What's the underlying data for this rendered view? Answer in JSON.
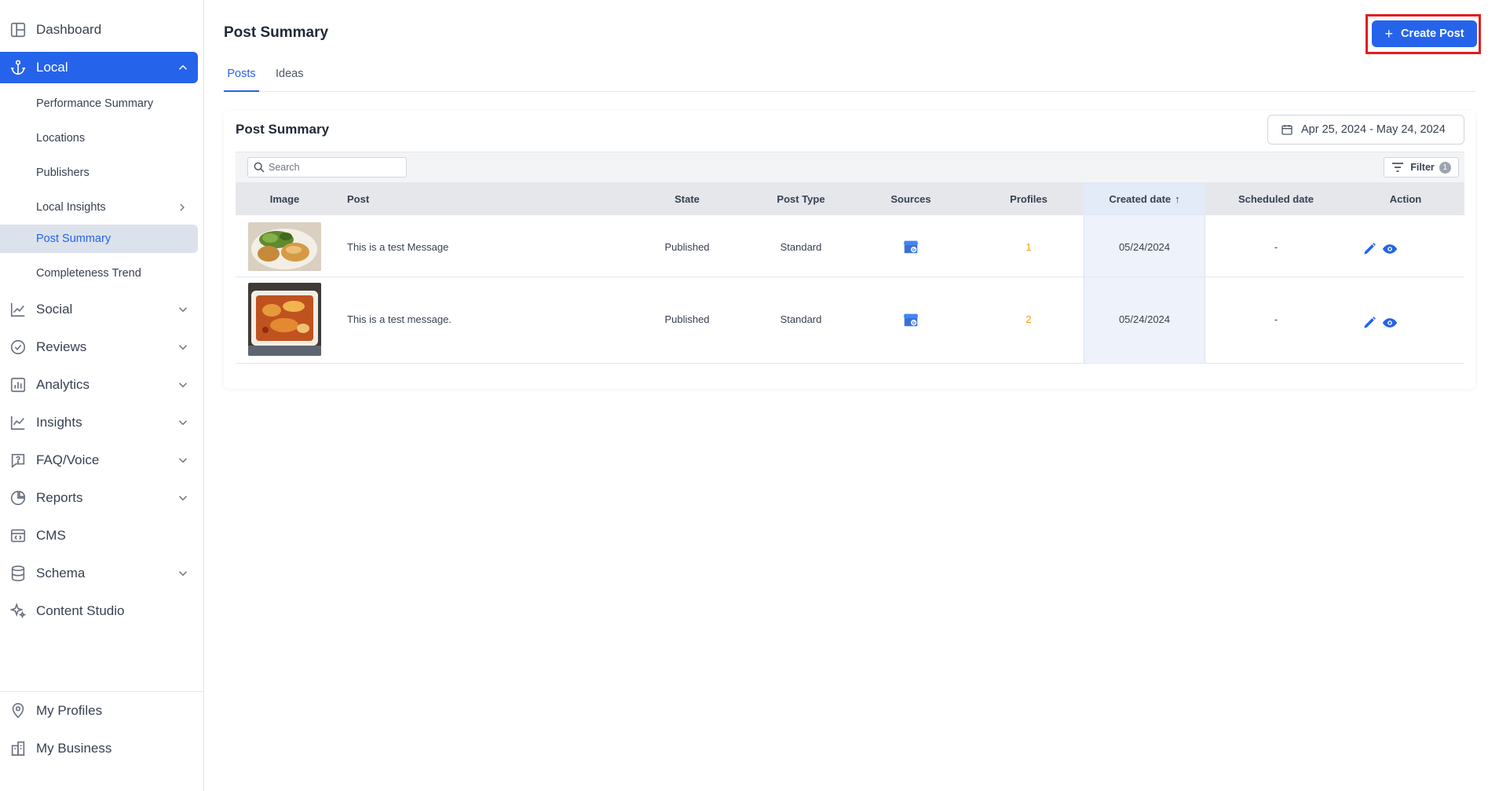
{
  "sidebar": {
    "top_items": [
      {
        "label": "Dashboard",
        "icon": "dashboard-icon"
      },
      {
        "label": "Local",
        "icon": "anchor-icon",
        "expanded": true
      }
    ],
    "local_sub": [
      {
        "label": "Performance Summary"
      },
      {
        "label": "Locations"
      },
      {
        "label": "Publishers"
      },
      {
        "label": "Local Insights",
        "has_children": true
      },
      {
        "label": "Post Summary",
        "selected": true
      },
      {
        "label": "Completeness Trend"
      }
    ],
    "sections": [
      {
        "label": "Social",
        "icon": "line-chart-icon"
      },
      {
        "label": "Reviews",
        "icon": "check-circle-icon"
      },
      {
        "label": "Analytics",
        "icon": "bar-chart-icon"
      },
      {
        "label": "Insights",
        "icon": "trend-icon"
      },
      {
        "label": "FAQ/Voice",
        "icon": "question-bubble-icon"
      },
      {
        "label": "Reports",
        "icon": "pie-chart-icon"
      },
      {
        "label": "CMS",
        "icon": "code-window-icon"
      },
      {
        "label": "Schema",
        "icon": "database-icon"
      },
      {
        "label": "Content Studio",
        "icon": "sparkles-icon"
      }
    ],
    "bottom": [
      {
        "label": "My Profiles",
        "icon": "location-pin-icon"
      },
      {
        "label": "My Business",
        "icon": "building-icon"
      }
    ]
  },
  "header": {
    "title": "Post Summary",
    "create_label": "Create Post"
  },
  "tabs": [
    {
      "label": "Posts",
      "active": true
    },
    {
      "label": "Ideas"
    }
  ],
  "card": {
    "title": "Post Summary",
    "date_range": "Apr 25, 2024 - May 24, 2024",
    "search_placeholder": "Search",
    "filter_label": "Filter",
    "filter_count": "1"
  },
  "table": {
    "columns": [
      "Image",
      "Post",
      "State",
      "Post Type",
      "Sources",
      "Profiles",
      "Created date",
      "Scheduled date",
      "Action"
    ],
    "sort_indicator": "↑",
    "rows": [
      {
        "post": "This is a test Message",
        "state": "Published",
        "post_type": "Standard",
        "source_icon": "google-business-icon",
        "profiles": "1",
        "created": "05/24/2024",
        "scheduled": "-",
        "image": "salad-chicken-photo"
      },
      {
        "post": "This is a test message.",
        "state": "Published",
        "post_type": "Standard",
        "source_icon": "google-business-icon",
        "profiles": "2",
        "created": "05/24/2024",
        "scheduled": "-",
        "image": "lasagna-photo"
      }
    ]
  },
  "colors": {
    "accent": "#2563eb",
    "highlight_box": "#e11d1d",
    "profiles_count": "#f59e0b"
  }
}
